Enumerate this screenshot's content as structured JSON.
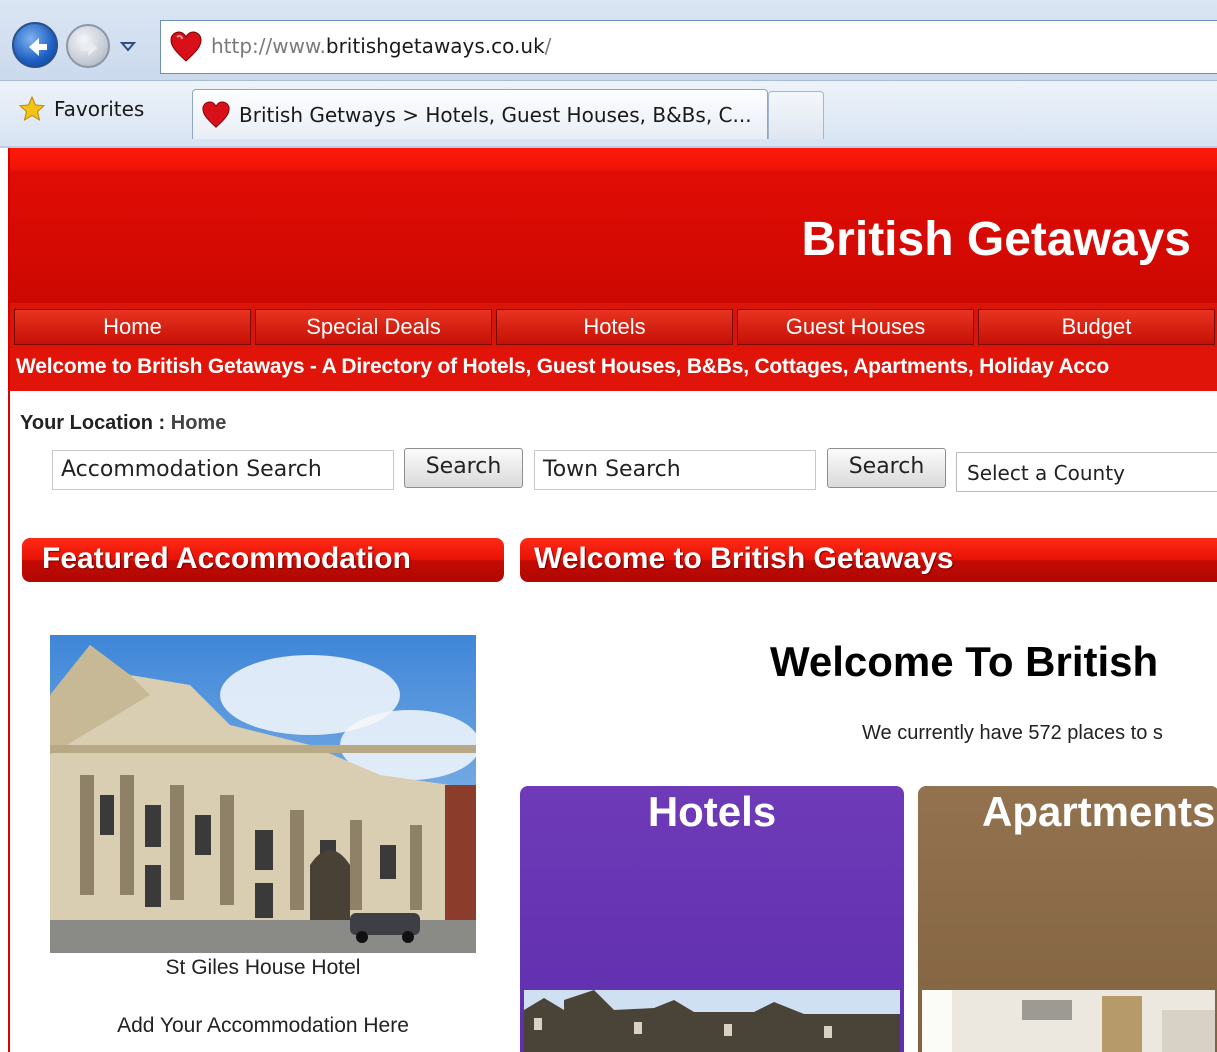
{
  "browser": {
    "url_prefix": "http://www.",
    "url_domain": "britishgetaways.co.uk",
    "url_suffix": "/",
    "favorites_label": "Favorites",
    "tab_title": "British Getways > Hotels, Guest Houses, B&Bs, C..."
  },
  "site": {
    "title": "British Getaways",
    "nav": [
      "Home",
      "Special Deals",
      "Hotels",
      "Guest Houses",
      "Budget"
    ],
    "ticker": "Welcome to British Getaways - A Directory of Hotels, Guest Houses, B&Bs, Cottages, Apartments, Holiday Acco",
    "location_label": "Your Location :",
    "location_value": "Home",
    "search": {
      "accommodation_placeholder": "Accommodation Search",
      "town_placeholder": "Town Search",
      "button_label": "Search",
      "county_select": "Select a County"
    },
    "featured_header": "Featured Accommodation",
    "welcome_header": "Welcome to British Getaways",
    "featured_caption": "St Giles House Hotel",
    "add_accommodation": "Add Your Accommodation Here",
    "welcome_title": "Welcome To British",
    "count_text": "We currently have 572 places to s",
    "tiles": {
      "hotels": "Hotels",
      "apartments": "Apartments"
    }
  },
  "colors": {
    "brand_red": "#d91408",
    "hotels_tile": "#6e3ab8",
    "apartments_tile": "#8a6b4a"
  },
  "icons": [
    "back-arrow-icon",
    "forward-arrow-icon",
    "dropdown-icon",
    "heart-favicon-icon",
    "favorites-star-icon"
  ]
}
